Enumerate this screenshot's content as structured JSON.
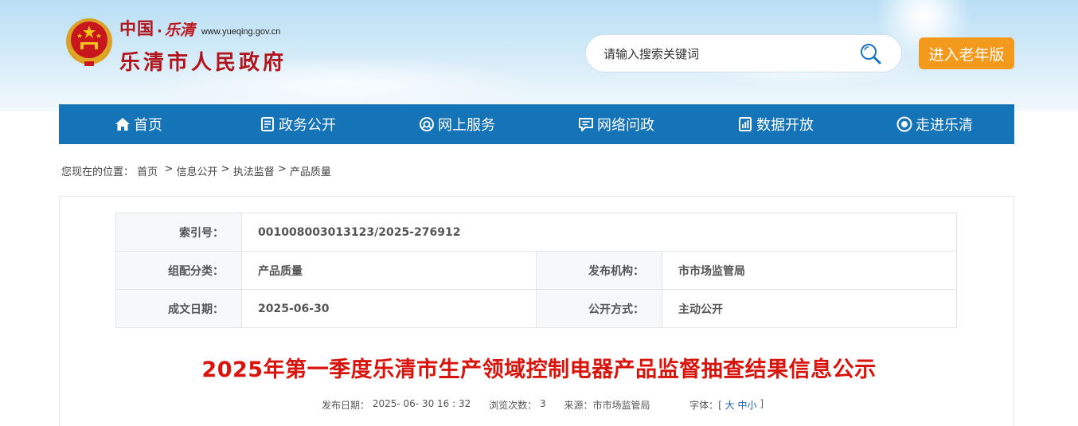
{
  "header": {
    "logo_country": "中国",
    "logo_dot": "·",
    "logo_city_script": "乐清",
    "logo_url": "www.yueqing.gov.cn",
    "logo_main": "乐清市人民政府",
    "search_placeholder": "请输入搜索关键词",
    "elder_mode_label": "进入老年版"
  },
  "nav": {
    "items": [
      {
        "label": "首页",
        "icon": "home-icon"
      },
      {
        "label": "政务公开",
        "icon": "document-icon"
      },
      {
        "label": "网上服务",
        "icon": "service-icon"
      },
      {
        "label": "网络问政",
        "icon": "chat-icon"
      },
      {
        "label": "数据开放",
        "icon": "data-icon"
      },
      {
        "label": "走进乐清",
        "icon": "eye-icon"
      }
    ]
  },
  "breadcrumb": {
    "prefix": "您现在的位置：",
    "items": [
      "首页",
      "信息公开",
      "执法监督",
      "产品质量"
    ],
    "separator": ">"
  },
  "meta": {
    "index_label": "索引号：",
    "index_value": "001008003013123/2025-276912",
    "category_label": "组配分类：",
    "category_value": "产品质量",
    "publisher_label": "发布机构：",
    "publisher_value": "市市场监管局",
    "date_label": "成文日期：",
    "date_value": "2025-06-30",
    "disclosure_label": "公开方式：",
    "disclosure_value": "主动公开"
  },
  "article": {
    "title": "2025年第一季度乐清市生产领域控制电器产品监督抽查结果信息公示",
    "publish_label": "发布日期：",
    "publish_value": "2025- 06- 30 16 : 32",
    "views_label": "浏览次数：",
    "views_value": "3",
    "source_label": "来源：",
    "source_value": "市市场监管局",
    "font_label": "字体：[",
    "font_large": "大",
    "font_medium": "中",
    "font_small": "小",
    "font_close": "]"
  },
  "colors": {
    "nav_bg": "#1573b8",
    "title_red": "#d8140c",
    "elder_btn": "#f39a1d",
    "logo_red": "#b2141b"
  }
}
